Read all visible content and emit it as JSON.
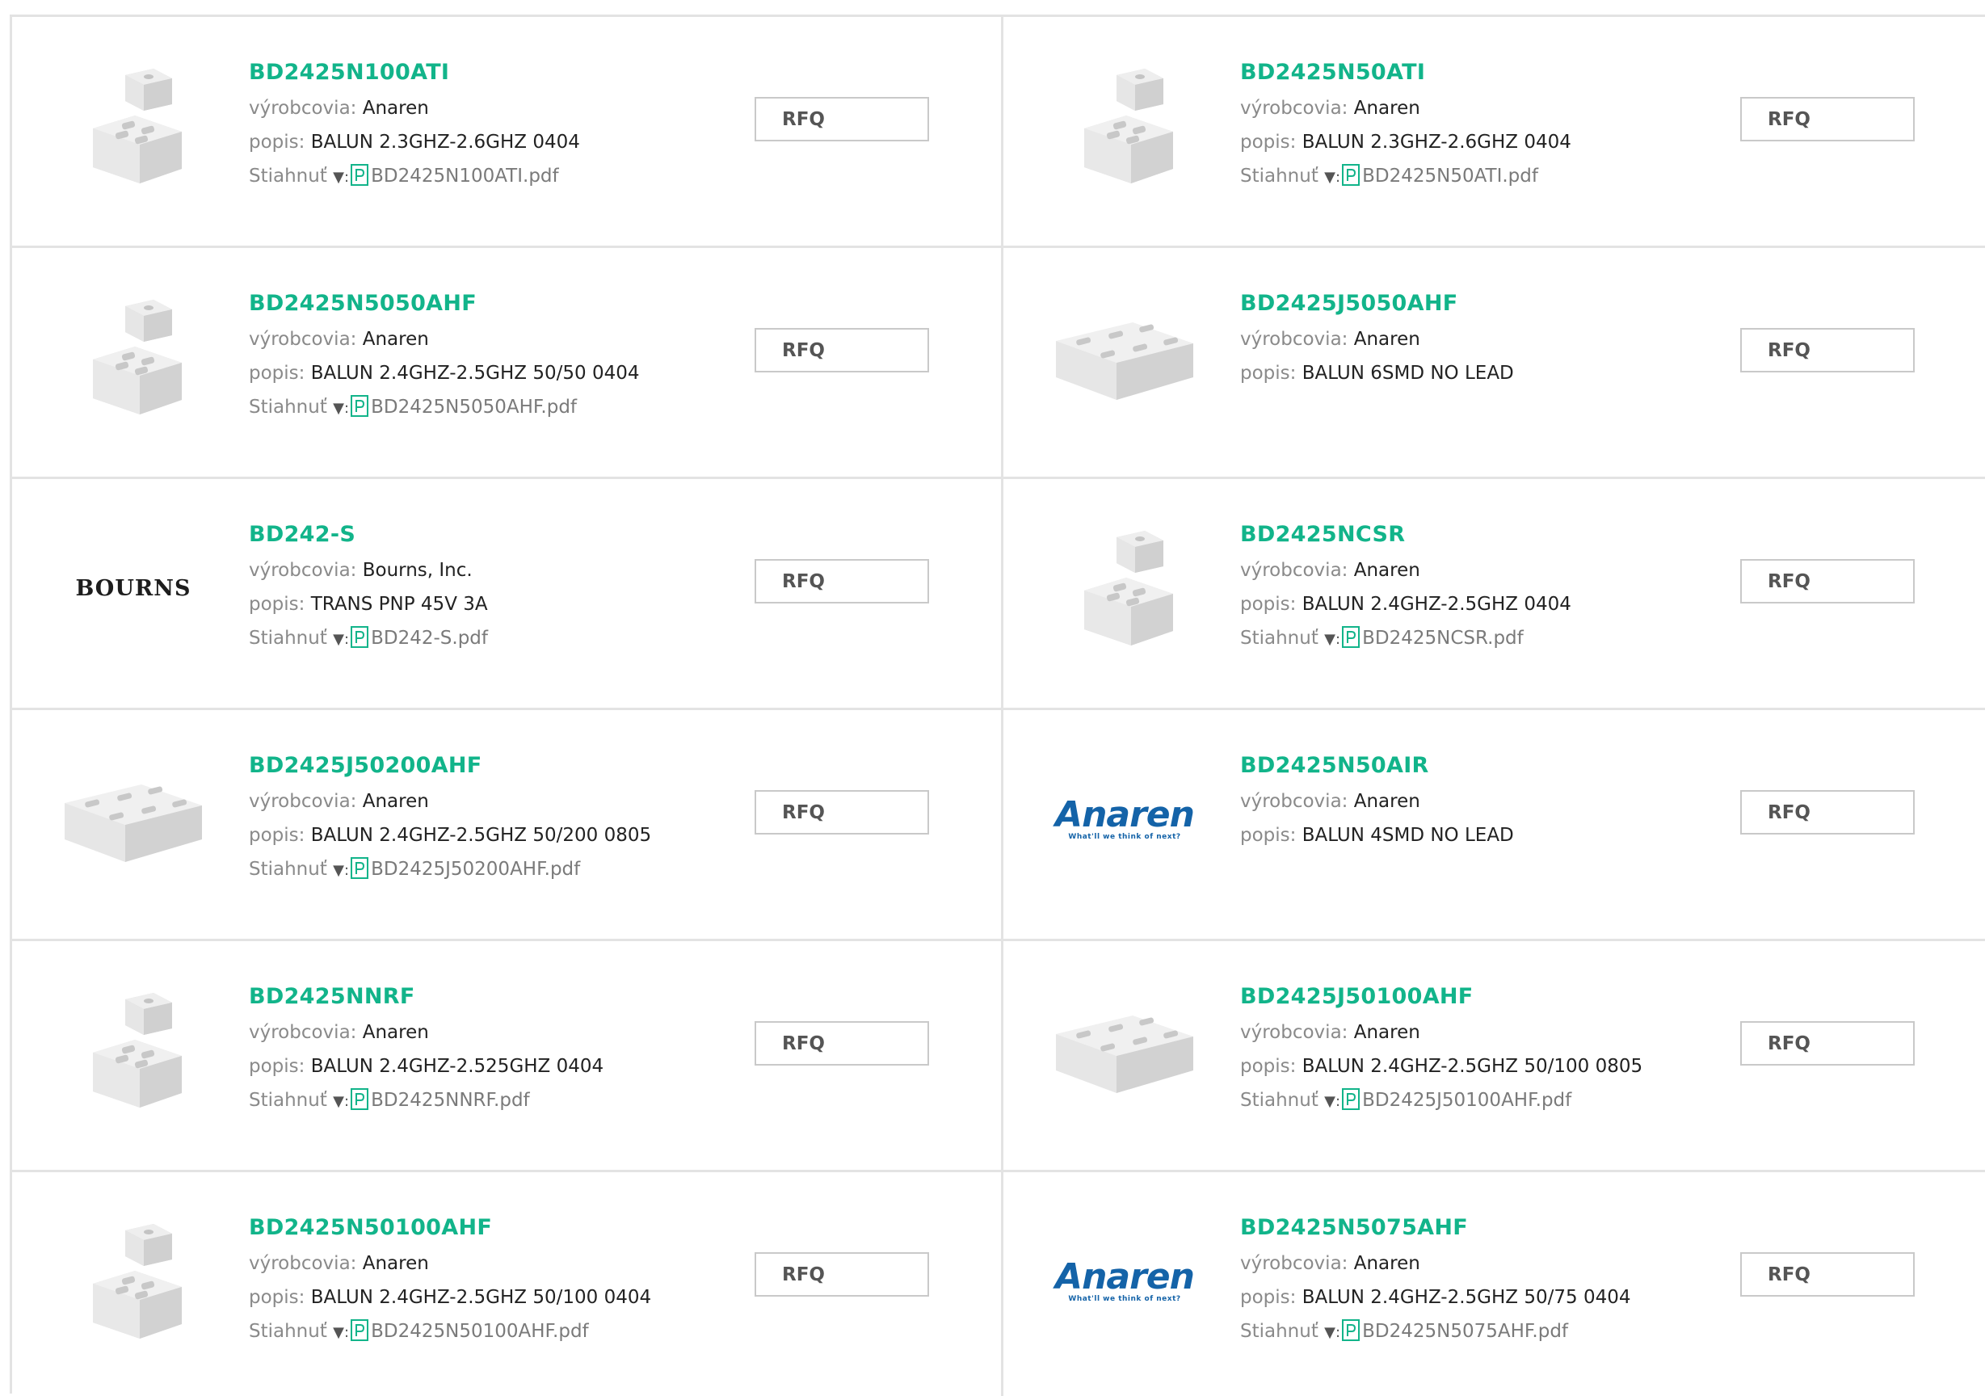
{
  "labels": {
    "manufacturer": "výrobcovia:",
    "description": "popis:",
    "download": "Stiahnuť",
    "download_arrow": "▼:",
    "rfq": "RFQ"
  },
  "logos": {
    "bourns": "BOURNS",
    "anaren": "Anaren",
    "anaren_tagline": "What'll we think of next?"
  },
  "colors": {
    "part_number": "#12b48a",
    "anaren_blue": "#1463a8",
    "border": "#e3e3e3"
  },
  "products": [
    {
      "part": "BD2425N100ATI",
      "manufacturer": "Anaren",
      "description": "BALUN 2.3GHZ-2.6GHZ 0404",
      "pdf": "BD2425N100ATI.pdf",
      "image": "stacked-chip-icon"
    },
    {
      "part": "BD2425N50ATI",
      "manufacturer": "Anaren",
      "description": "BALUN 2.3GHZ-2.6GHZ 0404",
      "pdf": "BD2425N50ATI.pdf",
      "image": "stacked-chip-icon"
    },
    {
      "part": "BD2425N5050AHF",
      "manufacturer": "Anaren",
      "description": "BALUN 2.4GHZ-2.5GHZ 50/50 0404",
      "pdf": "BD2425N5050AHF.pdf",
      "image": "stacked-chip-icon"
    },
    {
      "part": "BD2425J5050AHF",
      "manufacturer": "Anaren",
      "description": "BALUN 6SMD NO LEAD",
      "pdf": null,
      "image": "flat-chip-icon"
    },
    {
      "part": "BD242-S",
      "manufacturer": "Bourns, Inc.",
      "description": "TRANS PNP 45V 3A",
      "pdf": "BD242-S.pdf",
      "image": "bourns-logo"
    },
    {
      "part": "BD2425NCSR",
      "manufacturer": "Anaren",
      "description": "BALUN 2.4GHZ-2.5GHZ 0404",
      "pdf": "BD2425NCSR.pdf",
      "image": "stacked-chip-icon"
    },
    {
      "part": "BD2425J50200AHF",
      "manufacturer": "Anaren",
      "description": "BALUN 2.4GHZ-2.5GHZ 50/200 0805",
      "pdf": "BD2425J50200AHF.pdf",
      "image": "flat-chip-icon"
    },
    {
      "part": "BD2425N50AIR",
      "manufacturer": "Anaren",
      "description": "BALUN 4SMD NO LEAD",
      "pdf": null,
      "image": "anaren-logo"
    },
    {
      "part": "BD2425NNRF",
      "manufacturer": "Anaren",
      "description": "BALUN 2.4GHZ-2.525GHZ 0404",
      "pdf": "BD2425NNRF.pdf",
      "image": "stacked-chip-icon"
    },
    {
      "part": "BD2425J50100AHF",
      "manufacturer": "Anaren",
      "description": "BALUN 2.4GHZ-2.5GHZ 50/100 0805",
      "pdf": "BD2425J50100AHF.pdf",
      "image": "flat-chip-icon"
    },
    {
      "part": "BD2425N50100AHF",
      "manufacturer": "Anaren",
      "description": "BALUN 2.4GHZ-2.5GHZ 50/100 0404",
      "pdf": "BD2425N50100AHF.pdf",
      "image": "stacked-chip-icon"
    },
    {
      "part": "BD2425N5075AHF",
      "manufacturer": "Anaren",
      "description": "BALUN 2.4GHZ-2.5GHZ 50/75 0404",
      "pdf": "BD2425N5075AHF.pdf",
      "image": "anaren-logo"
    }
  ]
}
